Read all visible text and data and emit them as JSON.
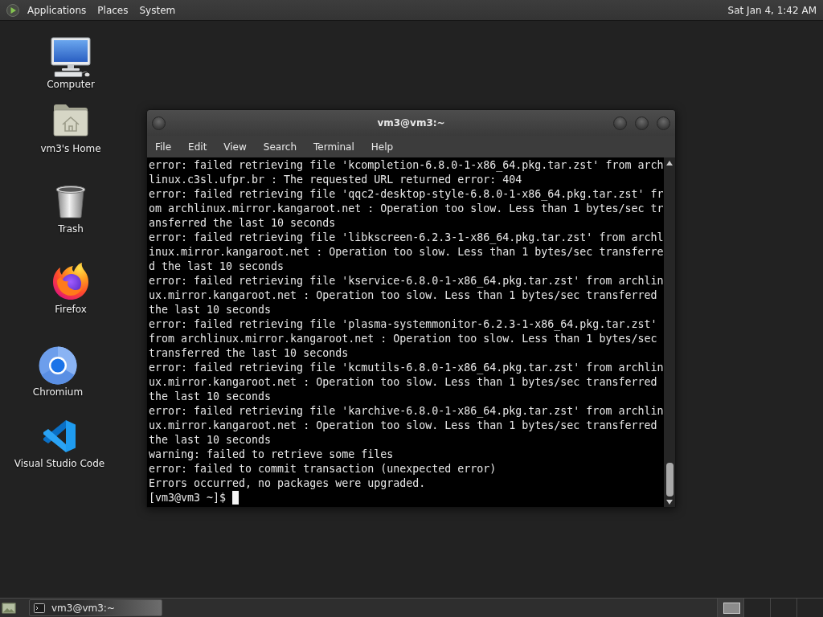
{
  "top_panel": {
    "menus": [
      "Applications",
      "Places",
      "System"
    ],
    "clock": "Sat Jan 4, 1:42 AM"
  },
  "desktop_icons": [
    {
      "label": "Computer",
      "kind": "computer"
    },
    {
      "label": "vm3's Home",
      "kind": "home"
    },
    {
      "label": "Trash",
      "kind": "trash"
    },
    {
      "label": "Firefox",
      "kind": "firefox"
    },
    {
      "label": "Chromium",
      "kind": "chromium"
    },
    {
      "label": "Visual Studio Code",
      "kind": "vscode"
    }
  ],
  "terminal_window": {
    "title": "vm3@vm3:~",
    "menu": [
      "File",
      "Edit",
      "View",
      "Search",
      "Terminal",
      "Help"
    ],
    "lines": [
      "error: failed retrieving file 'kcompletion-6.8.0-1-x86_64.pkg.tar.zst' from archlinux.c3sl.ufpr.br : The requested URL returned error: 404",
      "error: failed retrieving file 'qqc2-desktop-style-6.8.0-1-x86_64.pkg.tar.zst' from archlinux.mirror.kangaroot.net : Operation too slow. Less than 1 bytes/sec transferred the last 10 seconds",
      "error: failed retrieving file 'libkscreen-6.2.3-1-x86_64.pkg.tar.zst' from archlinux.mirror.kangaroot.net : Operation too slow. Less than 1 bytes/sec transferred the last 10 seconds",
      "error: failed retrieving file 'kservice-6.8.0-1-x86_64.pkg.tar.zst' from archlinux.mirror.kangaroot.net : Operation too slow. Less than 1 bytes/sec transferred the last 10 seconds",
      "error: failed retrieving file 'plasma-systemmonitor-6.2.3-1-x86_64.pkg.tar.zst' from archlinux.mirror.kangaroot.net : Operation too slow. Less than 1 bytes/sec transferred the last 10 seconds",
      "error: failed retrieving file 'kcmutils-6.8.0-1-x86_64.pkg.tar.zst' from archlinux.mirror.kangaroot.net : Operation too slow. Less than 1 bytes/sec transferred the last 10 seconds",
      "error: failed retrieving file 'karchive-6.8.0-1-x86_64.pkg.tar.zst' from archlinux.mirror.kangaroot.net : Operation too slow. Less than 1 bytes/sec transferred the last 10 seconds",
      "warning: failed to retrieve some files",
      "error: failed to commit transaction (unexpected error)",
      "Errors occurred, no packages were upgraded."
    ],
    "prompt": "[vm3@vm3 ~]$"
  },
  "bottom_panel": {
    "tasks": [
      {
        "label": "vm3@vm3:~",
        "selected": true
      }
    ],
    "workspaces": [
      {
        "selected": true
      },
      {
        "selected": false
      },
      {
        "selected": false
      },
      {
        "selected": false
      }
    ]
  }
}
